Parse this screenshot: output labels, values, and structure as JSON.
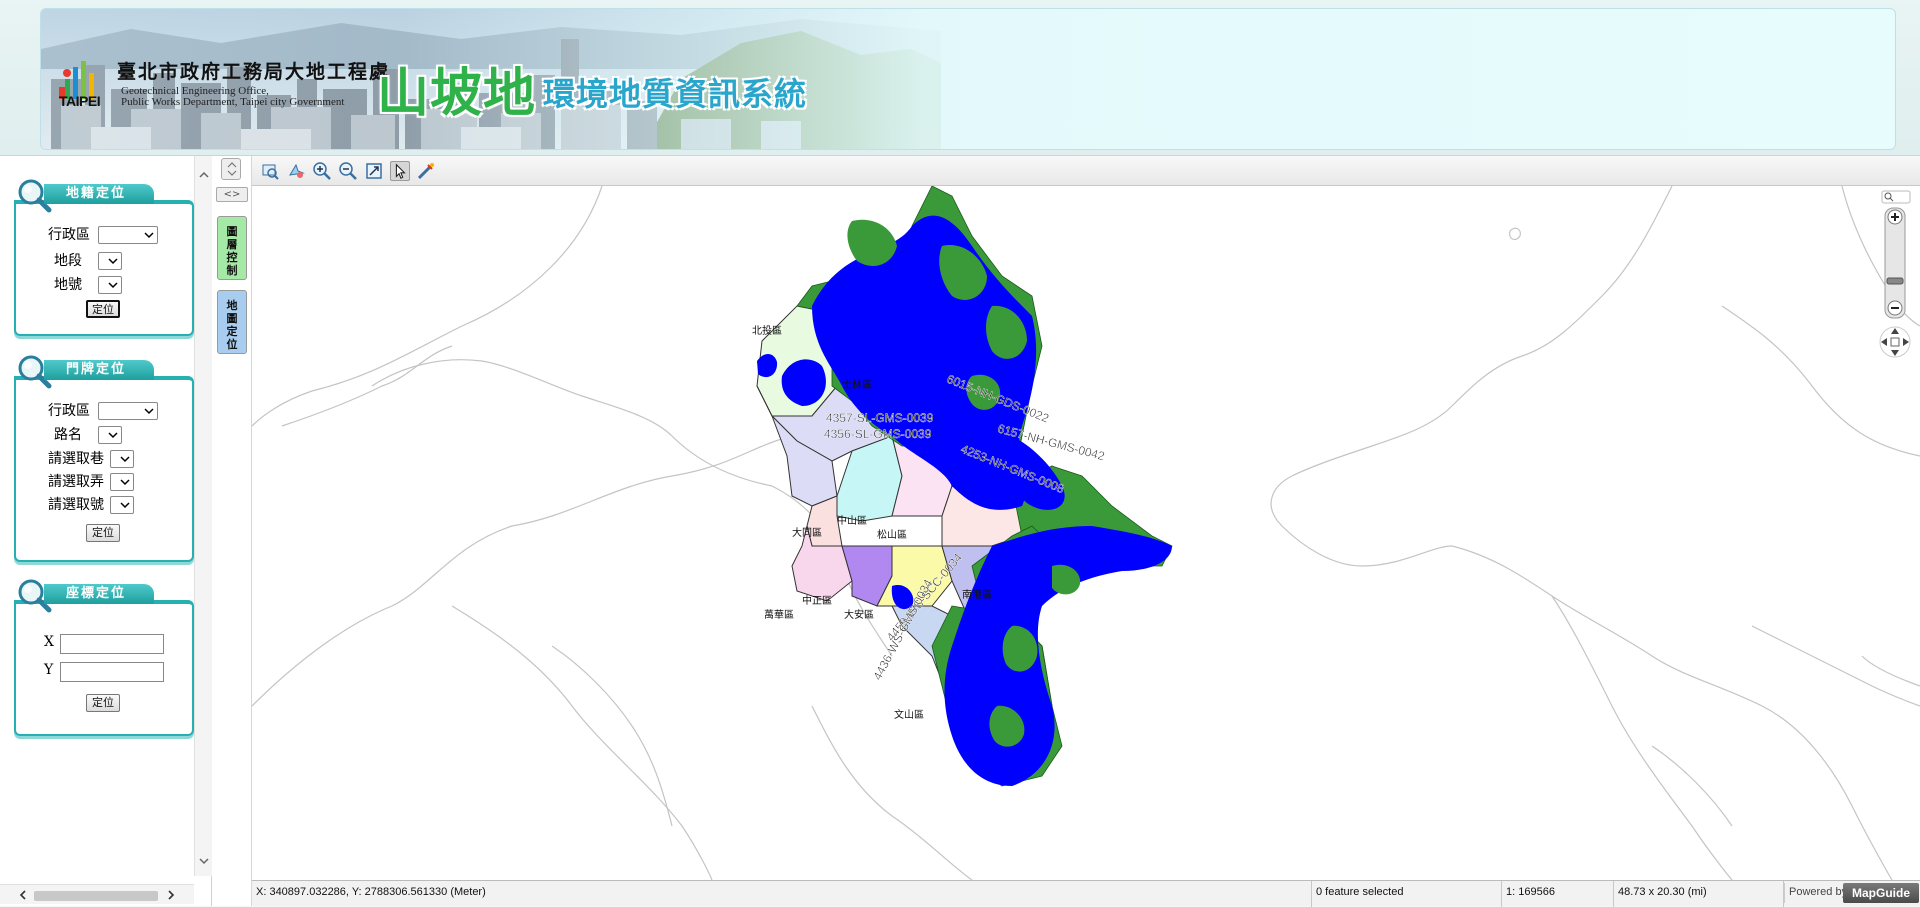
{
  "header": {
    "logo_text": "TAIPEI",
    "office_cn": "臺北市政府工務局大地工程處",
    "office_en_line1": "Geotechnical Engineering Office,",
    "office_en_line2": "Public Works Department, Taipei city Government",
    "title_main": "山坡地",
    "title_sub": "環境地質資訊系統"
  },
  "sidebar": {
    "cadastral": {
      "title": "地籍定位",
      "district_label": "行政區",
      "section_label": "地段",
      "lot_label": "地號",
      "locate_button": "定位"
    },
    "address": {
      "title": "門牌定位",
      "district_label": "行政區",
      "road_label": "路名",
      "lane_label": "請選取巷",
      "alley_label": "請選取弄",
      "number_label": "請選取號",
      "locate_button": "定位"
    },
    "coordinate": {
      "title": "座標定位",
      "x_label": "X",
      "y_label": "Y",
      "x_value": "",
      "y_value": "",
      "locate_button": "定位"
    }
  },
  "strip": {
    "toggle_label": "<>",
    "tab_layers": "圖層控制",
    "tab_map_locate": "地圖定位"
  },
  "toolbar": {
    "tools": [
      "refresh-map-icon",
      "pan-icon",
      "zoom-in-icon",
      "zoom-out-icon",
      "zoom-extent-icon",
      "select-icon",
      "measure-icon"
    ],
    "active_tool": "select-icon"
  },
  "map": {
    "district_labels": [
      "北投區",
      "士林區",
      "中山區",
      "松山區",
      "大同區",
      "萬華區",
      "中正區",
      "大安區",
      "南港區",
      "文山區"
    ],
    "feature_labels": [
      "4357-SL-GMS-0039",
      "4356-SL-GMS-0039",
      "6015-NH-GDS-0022",
      "6157-NH-GMS-0042",
      "4253-NH-GMS-0008",
      "4459-WS-SCC-0034",
      "4436-WS-GMS-0034"
    ],
    "colors": {
      "slope_green": "#3a9a3a",
      "hazard_blue": "#0000ff",
      "boundary": "#bdbdbd"
    }
  },
  "status": {
    "coordinates": "X: 340897.032286, Y: 2788306.561330 (Meter)",
    "selection": "0 feature selected",
    "scale": "1: 169566",
    "extent": "48.73 x 20.30 (mi)",
    "powered_by": "Powered by",
    "brand": "MapGuide"
  }
}
